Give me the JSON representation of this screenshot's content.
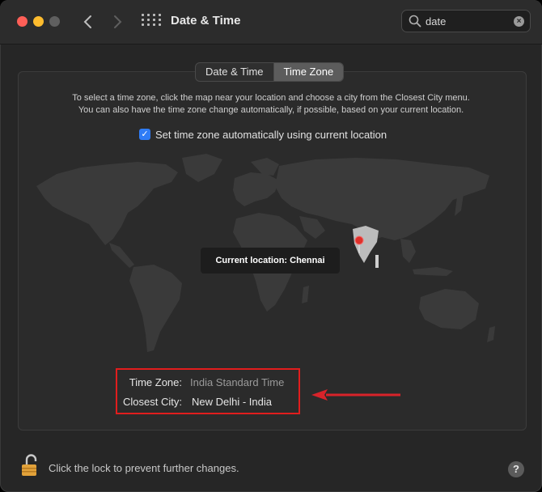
{
  "window": {
    "title": "Date & Time",
    "back_icon": "chevron-left-icon",
    "forward_icon": "chevron-right-icon",
    "grid_icon": "show-all-grid-icon"
  },
  "search": {
    "value": "date",
    "icon": "search-icon",
    "clear_icon": "clear-icon"
  },
  "tabs": [
    {
      "label": "Date & Time",
      "active": false
    },
    {
      "label": "Time Zone",
      "active": true
    }
  ],
  "timezone": {
    "help_line1": "To select a time zone, click the map near your location and choose a city from the Closest City menu.",
    "help_line2": "You can also have the time zone change automatically, if possible, based on your current location.",
    "auto_checked": true,
    "auto_label": "Set time zone automatically using current location",
    "current_location": "Current location: Chennai",
    "time_zone_label": "Time Zone:",
    "time_zone_value": "India Standard Time",
    "closest_city_label": "Closest City:",
    "closest_city_value": "New Delhi - India"
  },
  "footer": {
    "lock_text": "Click the lock to prevent further changes.",
    "lock_icon": "lock-open-icon",
    "help_label": "?"
  },
  "colors": {
    "highlight_box": "#e11d1d",
    "checkbox": "#2f7cf6",
    "map_land": "#3a3a3a",
    "pin": "#e0302a"
  }
}
